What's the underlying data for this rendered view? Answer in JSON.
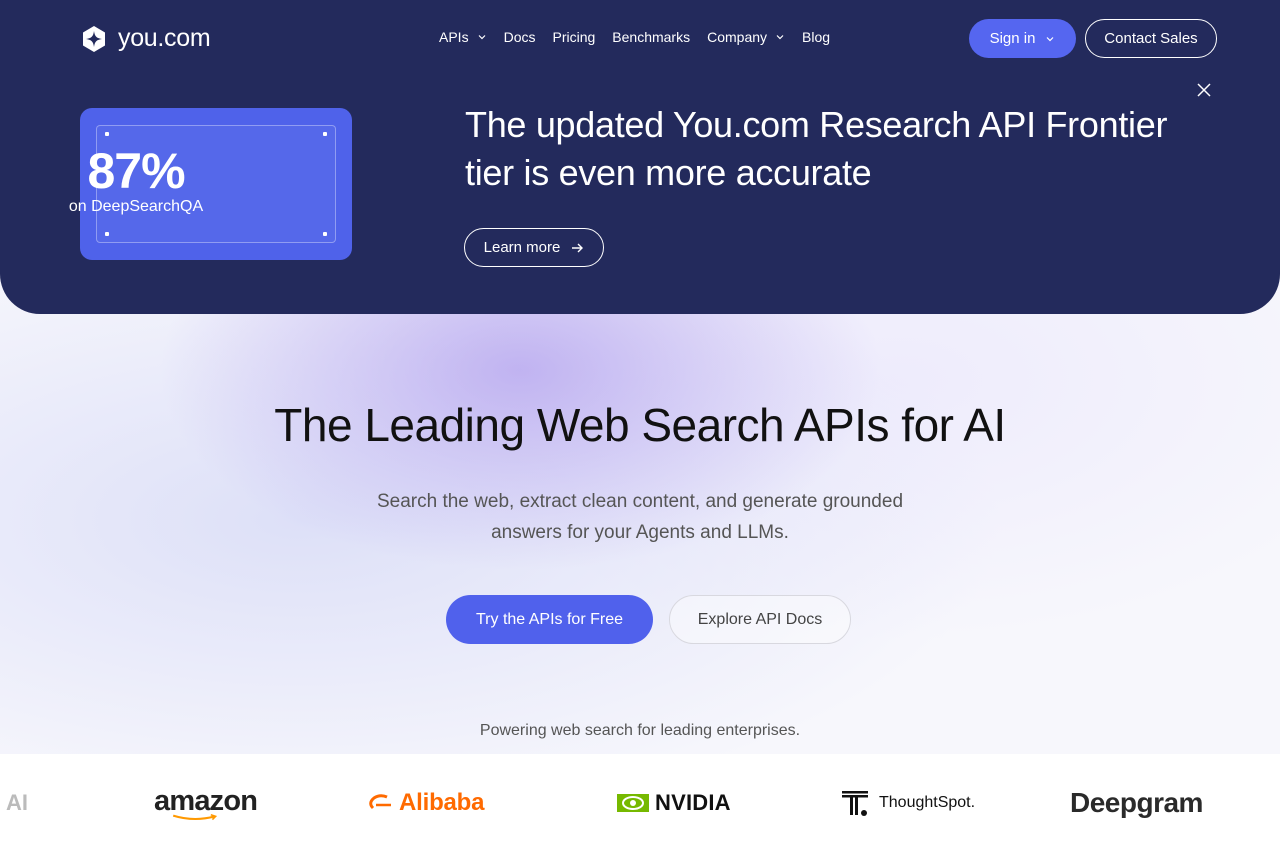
{
  "header": {
    "brand": "you.com",
    "nav": [
      {
        "label": "APIs",
        "has_dropdown": true
      },
      {
        "label": "Docs",
        "has_dropdown": false
      },
      {
        "label": "Pricing",
        "has_dropdown": false
      },
      {
        "label": "Benchmarks",
        "has_dropdown": false
      },
      {
        "label": "Company",
        "has_dropdown": true
      },
      {
        "label": "Blog",
        "has_dropdown": false
      }
    ],
    "signin_label": "Sign in",
    "contact_label": "Contact Sales"
  },
  "banner": {
    "stat_value": "87%",
    "stat_label": "on DeepSearchQA",
    "title": "The updated You.com Research API Frontier tier is even more accurate",
    "learn_more_label": "Learn more"
  },
  "hero": {
    "headline": "The Leading Web Search APIs for AI",
    "subhead": "Search the web, extract clean content, and generate grounded answers for your Agents and LLMs.",
    "primary_cta": "Try the APIs for Free",
    "secondary_cta": "Explore API Docs"
  },
  "customers": {
    "caption": "Powering web search for leading enterprises.",
    "logos": [
      "AI",
      "amazon",
      "Alibaba",
      "NVIDIA",
      "ThoughtSpot.",
      "Deepgram"
    ]
  },
  "colors": {
    "navy": "#232a5c",
    "accent": "#5061ec",
    "alibaba": "#ff6a00",
    "nvidia": "#76b900"
  }
}
